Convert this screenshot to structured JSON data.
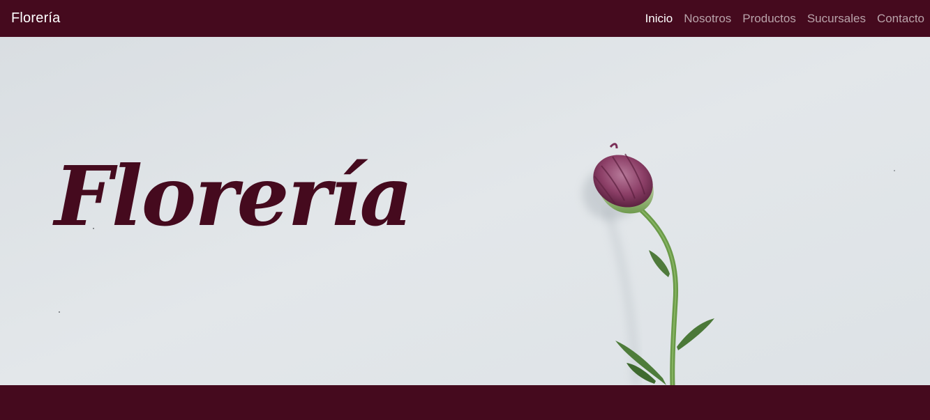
{
  "navbar": {
    "brand": "Florería",
    "links": [
      {
        "label": "Inicio",
        "active": true
      },
      {
        "label": "Nosotros",
        "active": false
      },
      {
        "label": "Productos",
        "active": false
      },
      {
        "label": "Sucursales",
        "active": false
      },
      {
        "label": "Contacto",
        "active": false
      }
    ]
  },
  "hero": {
    "title": "Florería",
    "image": "flower-bud-photo"
  },
  "colors": {
    "brand": "#450a1e",
    "nav_text_active": "#ffffff",
    "nav_text_inactive": "#b9a3aa",
    "hero_background": "#dfe3e7"
  }
}
